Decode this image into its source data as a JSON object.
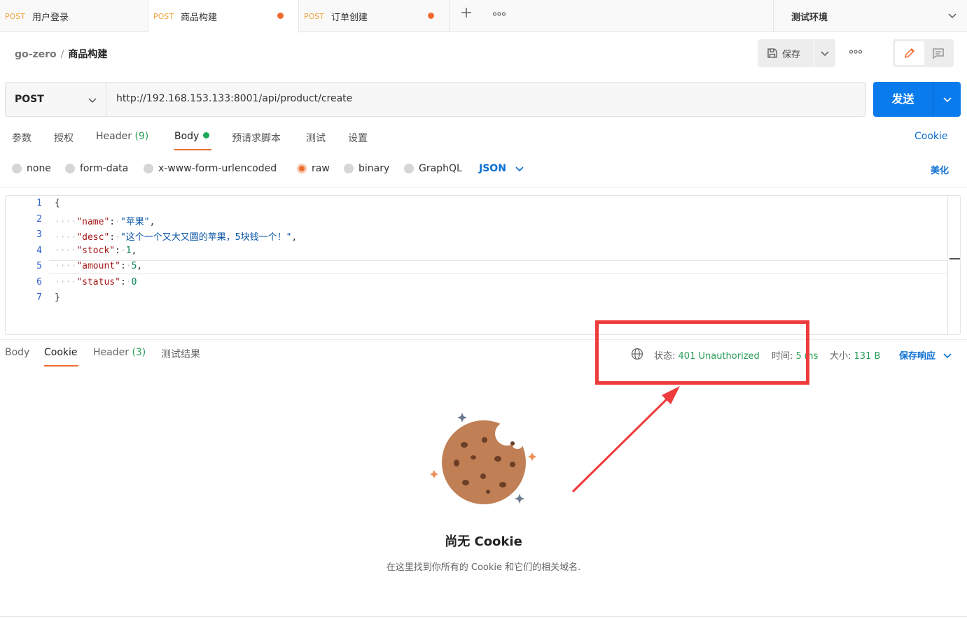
{
  "tabs": [
    {
      "method": "POST",
      "name": "用户登录",
      "active": false,
      "unsaved": false
    },
    {
      "method": "POST",
      "name": "商品构建",
      "active": true,
      "unsaved": true
    },
    {
      "method": "POST",
      "name": "订单创建",
      "active": false,
      "unsaved": true
    }
  ],
  "tabbar": {
    "new_tab_icon": "plus-icon",
    "more_icon": "more-horizontal-icon",
    "environment": "测试环境"
  },
  "breadcrumb": {
    "workspace": "go-zero",
    "separator": "/",
    "current": "商品构建"
  },
  "toolbar": {
    "save_label": "保存",
    "save_icon": "floppy-disk-icon",
    "more_icon": "more-horizontal-icon"
  },
  "request": {
    "method": "POST",
    "url": "http://192.168.153.133:8001/api/product/create",
    "send_label": "发送"
  },
  "request_tabs": {
    "params": "参数",
    "auth": "授权",
    "headers": "Header",
    "headers_count": "(9)",
    "body": "Body",
    "pre_request": "预请求脚本",
    "tests": "测试",
    "settings": "设置",
    "cookie_link": "Cookie"
  },
  "body_types": {
    "none": "none",
    "form_data": "form-data",
    "urlencoded": "x-www-form-urlencoded",
    "raw": "raw",
    "binary": "binary",
    "graphql": "GraphQL",
    "selected": "raw",
    "format": "JSON",
    "beautify": "美化"
  },
  "editor": {
    "line_numbers": [
      "1",
      "2",
      "3",
      "4",
      "5",
      "6",
      "7"
    ],
    "lines": {
      "l1": "{",
      "l2_key": "\"name\"",
      "l2_val": "\"苹果\"",
      "l3_key": "\"desc\"",
      "l3_val": "\"这个一个又大又圆的苹果，5块钱一个！\"",
      "l4_key": "\"stock\"",
      "l4_val": "1",
      "l5_key": "\"amount\"",
      "l5_val": "5",
      "l6_key": "\"status\"",
      "l6_val": "0",
      "l7": "}"
    }
  },
  "response": {
    "tabs": {
      "body": "Body",
      "cookie": "Cookie",
      "headers": "Header",
      "headers_count": "(3)",
      "test_results": "测试结果"
    },
    "status_label": "状态:",
    "status_value": "401 Unauthorized",
    "time_label": "时间:",
    "time_value": "5 ms",
    "size_label": "大小:",
    "size_value": "131 B",
    "save_response": "保存响应"
  },
  "empty_state": {
    "title": "尚无 Cookie",
    "subtitle": "在这里找到你所有的 Cookie 和它们的相关域名."
  },
  "colors": {
    "accent_orange": "#ef6c2f",
    "primary_blue": "#097bed",
    "link_blue": "#0b6fd3",
    "success_green": "#2a9d56",
    "annotation_red": "#ee3b3b",
    "method_post": "#f0a440"
  }
}
